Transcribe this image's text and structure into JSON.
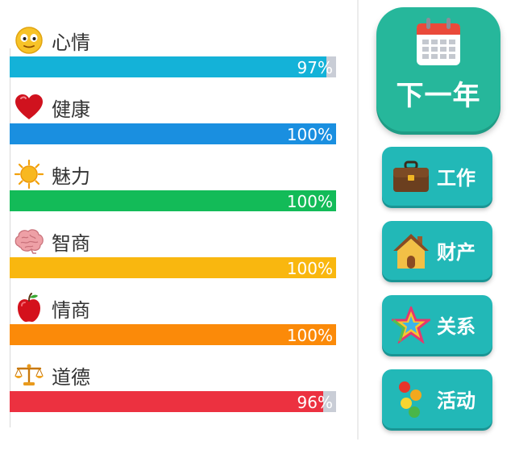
{
  "stats": [
    {
      "name": "心情",
      "icon": "smiley-face-icon",
      "value": "97%",
      "fraction": 0.97,
      "color": "#14b2d8"
    },
    {
      "name": "健康",
      "icon": "heart-icon",
      "value": "100%",
      "fraction": 1.0,
      "color": "#1a8fe0"
    },
    {
      "name": "魅力",
      "icon": "sun-icon",
      "value": "100%",
      "fraction": 1.0,
      "color": "#13bb58"
    },
    {
      "name": "智商",
      "icon": "brain-icon",
      "value": "100%",
      "fraction": 1.0,
      "color": "#f9b70f"
    },
    {
      "name": "情商",
      "icon": "apple-icon",
      "value": "100%",
      "fraction": 1.0,
      "color": "#fb8a09"
    },
    {
      "name": "道德",
      "icon": "scales-icon",
      "value": "96%",
      "fraction": 0.96,
      "color": "#ec3140"
    }
  ],
  "next_year": {
    "label": "下一年",
    "icon": "calendar-icon",
    "color": "#26b79b"
  },
  "actions": [
    {
      "label": "工作",
      "icon": "briefcase-icon"
    },
    {
      "label": "财产",
      "icon": "house-icon"
    },
    {
      "label": "关系",
      "icon": "star-icon"
    },
    {
      "label": "活动",
      "icon": "colored-dots-icon"
    }
  ],
  "colors": {
    "track": "#c9cdd6",
    "action_button": "#22b8b7"
  }
}
